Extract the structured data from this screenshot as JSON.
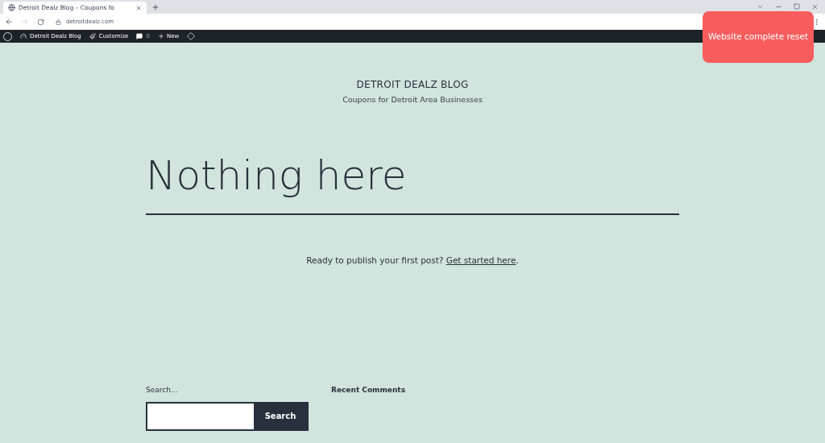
{
  "browser": {
    "tab_title": "Detroit Dealz Blog – Coupons fo",
    "url": "detroitdealz.com"
  },
  "admin_bar": {
    "site_name": "Detroit Dealz Blog",
    "customize": "Customize",
    "comments": "0",
    "new": "New"
  },
  "overlay": {
    "text": "Website complete reset"
  },
  "site": {
    "title": "DETROIT DEALZ BLOG",
    "tagline": "Coupons for Detroit Area Businesses"
  },
  "content": {
    "heading": "Nothing here",
    "message": "Ready to publish your first post?",
    "link": "Get started here",
    "after_link": "."
  },
  "widgets": {
    "search_label": "Search...",
    "search_button": "Search",
    "recent_comments": "Recent Comments"
  }
}
